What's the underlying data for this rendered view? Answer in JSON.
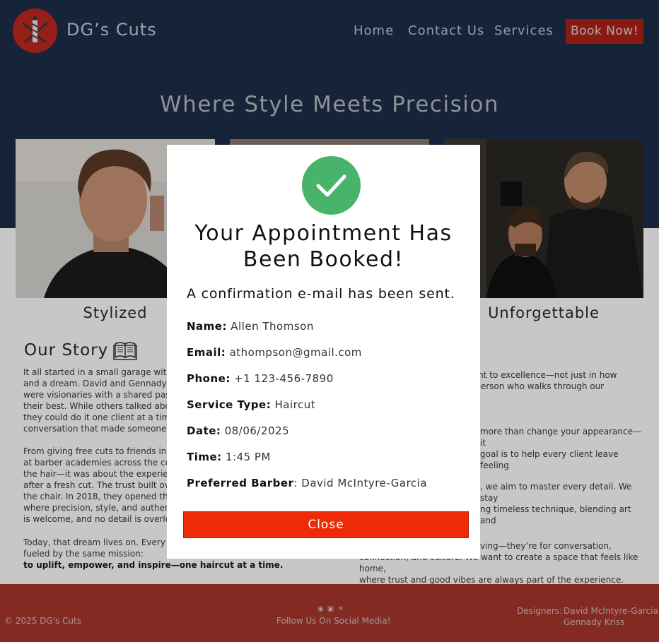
{
  "header": {
    "brand": "DG’s Cuts",
    "nav": [
      "Home",
      "Contact Us",
      "Services"
    ],
    "book_label": "Book Now!",
    "hero_title": "Where Style Meets Precision"
  },
  "gallery": {
    "captions": [
      "Stylized",
      "Unforgettable"
    ]
  },
  "story": {
    "title": "Our Story",
    "left_p1": [
      "It all started in a small garage with a",
      "and a dream.  David and Gennady we",
      "were visionaries with a shared passio",
      "their best. While others talked about",
      "they could do it one client at a time—",
      "conversation that made someone fee"
    ],
    "left_p2": [
      "From giving free cuts to friends in hi",
      "at barber academies across the count",
      "the hair—it was about the experience",
      "after a fresh cut. The trust built over",
      "the chair.  In 2018, they opened the d",
      "where precision, style, and authentic",
      "is welcome, and no detail is overlook"
    ],
    "left_p3": [
      "Today, that dream lives on. Every blac",
      "fueled by the same mission:"
    ],
    "left_p3_bold": "to uplift, empower, and inspire—one haircut at a time.",
    "right_p1": [
      "itment to excellence—not just in how",
      "ery person who walks through our"
    ],
    "right_p2": [
      "more than change your appearance—it",
      "goal is to help every client leave feeling"
    ],
    "right_p3": [
      ", we aim to master every detail. We stay",
      "ng timeless technique, blending art and"
    ],
    "right_p4": [
      "ving—they’re for conversation,",
      "connection, and culture. We want to create a space that feels like home,",
      "where trust and good vibes are always part of the experience."
    ]
  },
  "footer": {
    "copyright": "© 2025 DG's Cuts",
    "follow": "Follow Us On Social Media!",
    "designers_label": "Designers:",
    "designers": [
      "David McIntyre-Garcia",
      "Gennady Kriss"
    ]
  },
  "modal": {
    "title_line1": "Your Appointment Has",
    "title_line2": "Been Booked!",
    "subtitle": "A confirmation e-mail has been sent.",
    "fields": [
      {
        "label": "Name:",
        "value": "Allen Thomson"
      },
      {
        "label": "Email:",
        "value": "athompson@gmail.com"
      },
      {
        "label": "Phone:",
        "value": "+1 123-456-7890"
      },
      {
        "label": "Service Type:",
        "value": "Haircut"
      },
      {
        "label": "Date:",
        "value": "08/06/2025"
      },
      {
        "label": "Time:",
        "value": "1:45 PM"
      },
      {
        "label": "Preferred Barber",
        "value": ": David McIntyre-Garcia"
      }
    ],
    "close_label": "Close"
  },
  "colors": {
    "header_bg": "#1e2d4a",
    "accent_red": "#ad2219",
    "success_green": "#47b36b",
    "close_red": "#ee2b06",
    "footer_bg": "#a8362d"
  },
  "icons": [
    "barber-logo-icon",
    "open-book-icon",
    "checkmark-icon",
    "facebook-icon",
    "instagram-icon",
    "x-icon"
  ]
}
